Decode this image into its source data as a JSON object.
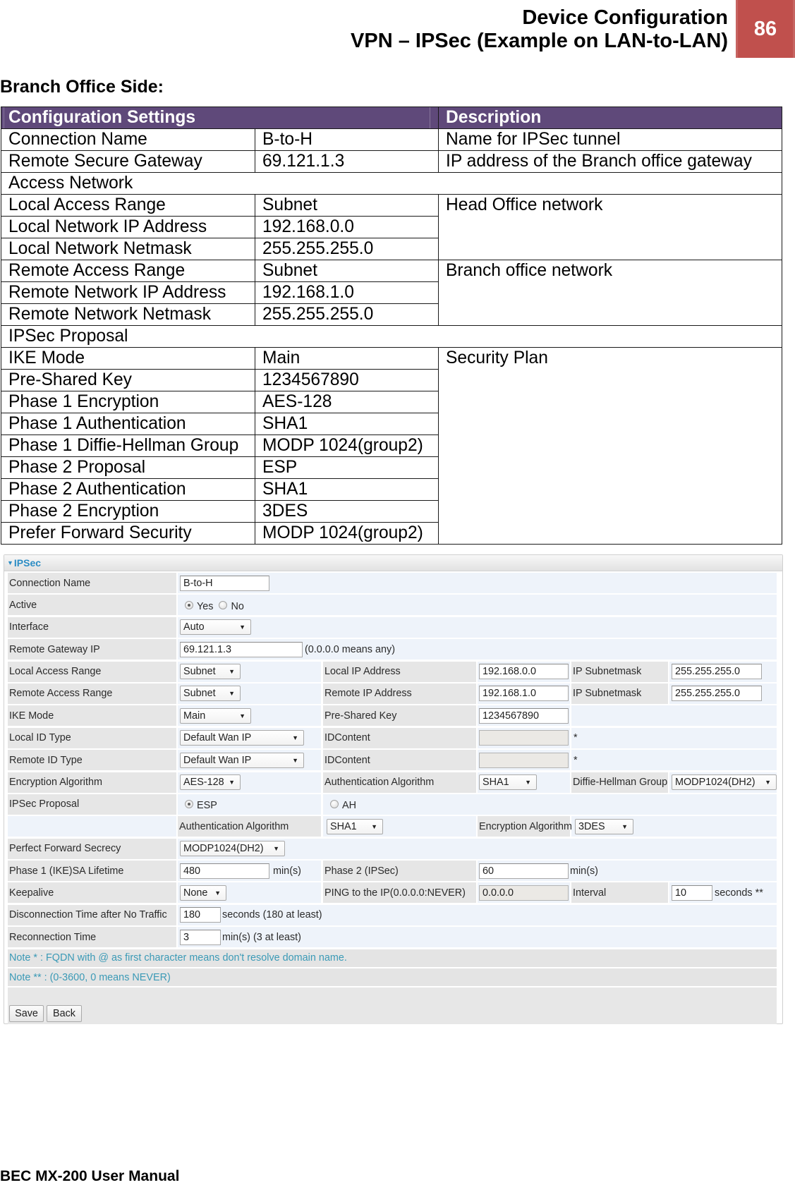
{
  "header": {
    "title": "Device Configuration",
    "subtitle": "VPN – IPSec (Example on LAN-to-LAN)",
    "page_number": "86"
  },
  "section_title": "Branch Office Side:",
  "config_table": {
    "headers": [
      "Configuration Settings",
      "Description"
    ],
    "rows": [
      {
        "setting": "Connection Name",
        "value": "B-to-H",
        "description": "Name for IPSec tunnel"
      },
      {
        "setting": "Remote Secure Gateway",
        "value": "69.121.1.3",
        "description": "IP address of the Branch office gateway"
      },
      {
        "section": "Access Network"
      },
      {
        "setting": "Local Access Range",
        "value": "Subnet",
        "description": "Head Office network"
      },
      {
        "setting": "Local Network IP Address",
        "value": "192.168.0.0"
      },
      {
        "setting": "Local Network Netmask",
        "value": "255.255.255.0"
      },
      {
        "setting": "Remote Access Range",
        "value": "Subnet",
        "description": "Branch office network"
      },
      {
        "setting": "Remote Network IP Address",
        "value": "192.168.1.0"
      },
      {
        "setting": "Remote Network Netmask",
        "value": "255.255.255.0"
      },
      {
        "section": "IPSec Proposal"
      },
      {
        "setting": "IKE Mode",
        "value": "Main",
        "description": "Security Plan"
      },
      {
        "setting": "Pre-Shared Key",
        "value": "1234567890"
      },
      {
        "setting": "Phase 1 Encryption",
        "value": "AES-128"
      },
      {
        "setting": "Phase 1 Authentication",
        "value": "SHA1"
      },
      {
        "setting": "Phase 1 Diffie-Hellman Group",
        "value": "MODP 1024(group2)"
      },
      {
        "setting": "Phase 2 Proposal",
        "value": "ESP"
      },
      {
        "setting": "Phase 2 Authentication",
        "value": "SHA1"
      },
      {
        "setting": "Phase 2 Encryption",
        "value": "3DES"
      },
      {
        "setting": "Prefer Forward Security",
        "value": "MODP 1024(group2)"
      }
    ]
  },
  "ipsec_panel": {
    "title": "IPSec",
    "collapse_icon": "triangle-down",
    "connection_name": {
      "label": "Connection Name",
      "value": "B-to-H"
    },
    "active": {
      "label": "Active",
      "options": [
        {
          "label": "Yes",
          "checked": true
        },
        {
          "label": "No",
          "checked": false
        }
      ]
    },
    "interface": {
      "label": "Interface",
      "value": "Auto"
    },
    "remote_gateway_ip": {
      "label": "Remote Gateway IP",
      "value": "69.121.1.3",
      "hint": "(0.0.0.0 means any)"
    },
    "local_access_range": {
      "label": "Local Access Range",
      "value": "Subnet",
      "ip_label": "Local IP Address",
      "ip_value": "192.168.0.0",
      "mask_label": "IP Subnetmask",
      "mask_value": "255.255.255.0"
    },
    "remote_access_range": {
      "label": "Remote Access Range",
      "value": "Subnet",
      "ip_label": "Remote IP Address",
      "ip_value": "192.168.1.0",
      "mask_label": "IP Subnetmask",
      "mask_value": "255.255.255.0"
    },
    "ike_mode": {
      "label": "IKE Mode",
      "value": "Main",
      "psk_label": "Pre-Shared Key",
      "psk_value": "1234567890"
    },
    "local_id_type": {
      "label": "Local ID Type",
      "value": "Default Wan IP",
      "content_label": "IDContent",
      "content_value": "",
      "marker": "*"
    },
    "remote_id_type": {
      "label": "Remote ID Type",
      "value": "Default Wan IP",
      "content_label": "IDContent",
      "content_value": "",
      "marker": "*"
    },
    "encryption_algorithm": {
      "label": "Encryption Algorithm",
      "value": "AES-128",
      "auth_label": "Authentication Algorithm",
      "auth_value": "SHA1",
      "dh_label": "Diffie-Hellman Group",
      "dh_value": "MODP1024(DH2)"
    },
    "ipsec_proposal": {
      "label": "IPSec Proposal",
      "options": [
        {
          "label": "ESP",
          "checked": true
        },
        {
          "label": "AH",
          "checked": false
        }
      ],
      "auth_label": "Authentication Algorithm",
      "auth_value": "SHA1",
      "enc_label": "Encryption Algorithm",
      "enc_value": "3DES"
    },
    "pfs": {
      "label": "Perfect Forward Secrecy",
      "value": "MODP1024(DH2)"
    },
    "phase1_lifetime": {
      "label": "Phase 1 (IKE)SA Lifetime",
      "value": "480",
      "unit": "min(s)",
      "phase2_label": "Phase 2 (IPSec)",
      "phase2_value": "60",
      "phase2_unit": "min(s)"
    },
    "keepalive": {
      "label": "Keepalive",
      "value": "None",
      "ping_label": "PING to the IP(0.0.0.0:NEVER)",
      "ping_value": "0.0.0.0",
      "interval_label": "Interval",
      "interval_value": "10",
      "interval_unit": "seconds **"
    },
    "disconnection_time": {
      "label": "Disconnection Time after No Traffic",
      "value": "180",
      "unit": "seconds (180 at least)"
    },
    "reconnection_time": {
      "label": "Reconnection Time",
      "value": "3",
      "unit": "min(s) (3 at least)"
    },
    "notes": [
      "Note * : FQDN with @ as first character means don't resolve domain name.",
      "Note ** : (0-3600, 0 means NEVER)"
    ],
    "buttons": {
      "save": "Save",
      "back": "Back"
    }
  },
  "footer": {
    "manual_title": "BEC MX-200 User Manual"
  },
  "colors": {
    "table_header_bg": "#5f497a",
    "page_badge_bg": "#c0504d",
    "panel_title": "#2b8cc4",
    "note_text": "#3b9ab6",
    "label_cell_bg": "#e6e6e6",
    "value_cell_bg": "#eef3fa"
  }
}
